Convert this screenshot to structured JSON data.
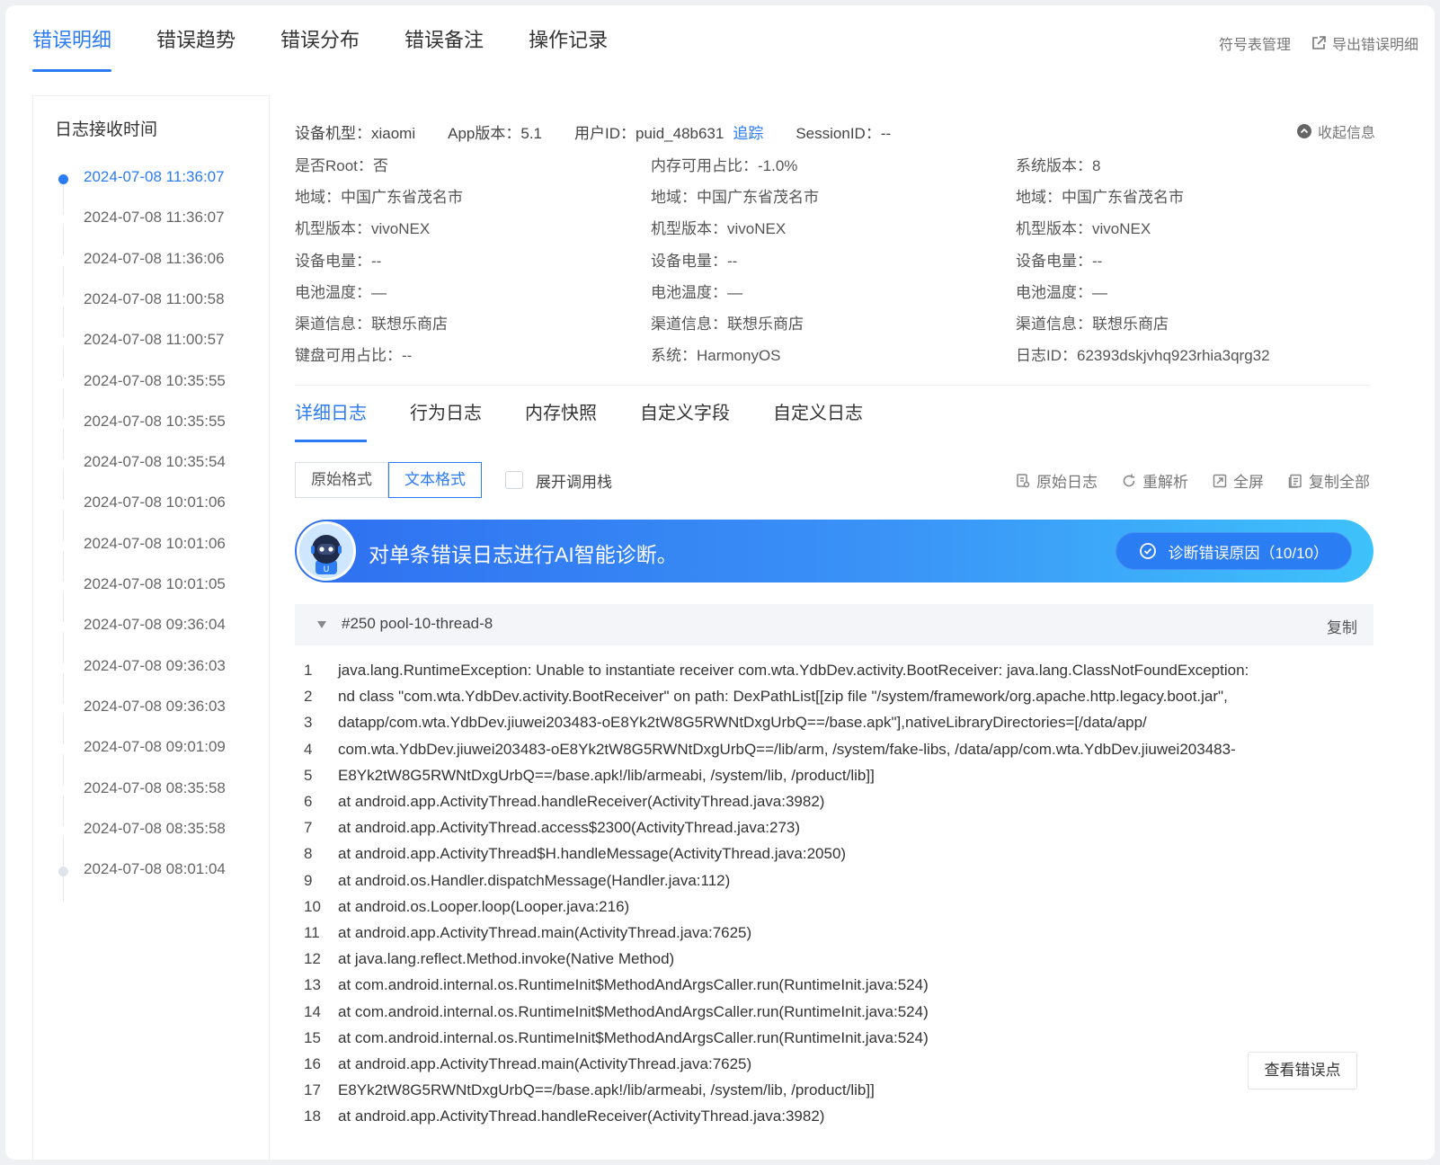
{
  "top_tabs": [
    "错误明细",
    "错误趋势",
    "错误分布",
    "错误备注",
    "操作记录"
  ],
  "top_actions": {
    "symbol_table": "符号表管理",
    "export": "导出错误明细"
  },
  "left": {
    "title": "日志接收时间",
    "times": [
      "2024-07-08 11:36:07",
      "2024-07-08 11:36:07",
      "2024-07-08 11:36:06",
      "2024-07-08 11:00:58",
      "2024-07-08 11:00:57",
      "2024-07-08 10:35:55",
      "2024-07-08 10:35:55",
      "2024-07-08 10:35:54",
      "2024-07-08 10:01:06",
      "2024-07-08 10:01:06",
      "2024-07-08 10:01:05",
      "2024-07-08 09:36:04",
      "2024-07-08 09:36:03",
      "2024-07-08 09:36:03",
      "2024-07-08 09:01:09",
      "2024-07-08 08:35:58",
      "2024-07-08 08:35:58",
      "2024-07-08 08:01:04"
    ]
  },
  "info": {
    "device_model": "设备机型：xiaomi",
    "app_version": "App版本：5.1",
    "user_id": "用户ID：puid_48b631",
    "track": "追踪",
    "session_id": "SessionID：--",
    "collapse": "收起信息",
    "grid": [
      [
        "是否Root：否",
        "内存可用占比：-1.0%",
        "系统版本：8"
      ],
      [
        "地域：中国广东省茂名市",
        "地域：中国广东省茂名市",
        "地域：中国广东省茂名市"
      ],
      [
        "机型版本：vivoNEX",
        "机型版本：vivoNEX",
        "机型版本：vivoNEX"
      ],
      [
        "设备电量：--",
        "设备电量：--",
        "设备电量：--"
      ],
      [
        "电池温度：—",
        "电池温度：—",
        "电池温度：—"
      ],
      [
        "渠道信息：联想乐商店",
        "渠道信息：联想乐商店",
        "渠道信息：联想乐商店"
      ],
      [
        "键盘可用占比：--",
        "系统：HarmonyOS",
        "日志ID：62393dskjvhq923rhia3qrg32"
      ]
    ]
  },
  "sub_tabs": [
    "详细日志",
    "行为日志",
    "内存快照",
    "自定义字段",
    "自定义日志"
  ],
  "format": {
    "raw": "原始格式",
    "text": "文本格式",
    "expand_stack": "展开调用栈"
  },
  "tools": {
    "raw_log": "原始日志",
    "reparse": "重解析",
    "fullscreen": "全屏",
    "copy_all": "复制全部"
  },
  "ai": {
    "text": "对单条错误日志进行AI智能诊断。",
    "button": "诊断错误原因（10/10）"
  },
  "thread": {
    "name": "#250 pool-10-thread-8",
    "copy": "复制"
  },
  "code_lines": [
    "java.lang.RuntimeException: Unable to instantiate receiver com.wta.YdbDev.activity.BootReceiver: java.lang.ClassNotFoundException:",
    "nd class \"com.wta.YdbDev.activity.BootReceiver\" on path: DexPathList[[zip file \"/system/framework/org.apache.http.legacy.boot.jar\",",
    "datapp/com.wta.YdbDev.jiuwei203483-oE8Yk2tW8G5RWNtDxgUrbQ==/base.apk\"],nativeLibraryDirectories=[/data/app/",
    "com.wta.YdbDev.jiuwei203483-oE8Yk2tW8G5RWNtDxgUrbQ==/lib/arm, /system/fake-libs, /data/app/com.wta.YdbDev.jiuwei203483-",
    "E8Yk2tW8G5RWNtDxgUrbQ==/base.apk!/lib/armeabi, /system/lib, /product/lib]]",
    "at android.app.ActivityThread.handleReceiver(ActivityThread.java:3982)",
    "at android.app.ActivityThread.access$2300(ActivityThread.java:273)",
    "at android.app.ActivityThread$H.handleMessage(ActivityThread.java:2050)",
    "at android.os.Handler.dispatchMessage(Handler.java:112)",
    "at android.os.Looper.loop(Looper.java:216)",
    "at android.app.ActivityThread.main(ActivityThread.java:7625)",
    "at java.lang.reflect.Method.invoke(Native Method)",
    "at com.android.internal.os.RuntimeInit$MethodAndArgsCaller.run(RuntimeInit.java:524)",
    "at com.android.internal.os.RuntimeInit$MethodAndArgsCaller.run(RuntimeInit.java:524)",
    "at com.android.internal.os.RuntimeInit$MethodAndArgsCaller.run(RuntimeInit.java:524)",
    "at android.app.ActivityThread.main(ActivityThread.java:7625)",
    "E8Yk2tW8G5RWNtDxgUrbQ==/base.apk!/lib/armeabi, /system/lib, /product/lib]]",
    "at android.app.ActivityThread.handleReceiver(ActivityThread.java:3982)"
  ],
  "view_error_point": "查看错误点",
  "colors": {
    "accent": "#2b7bf5"
  }
}
